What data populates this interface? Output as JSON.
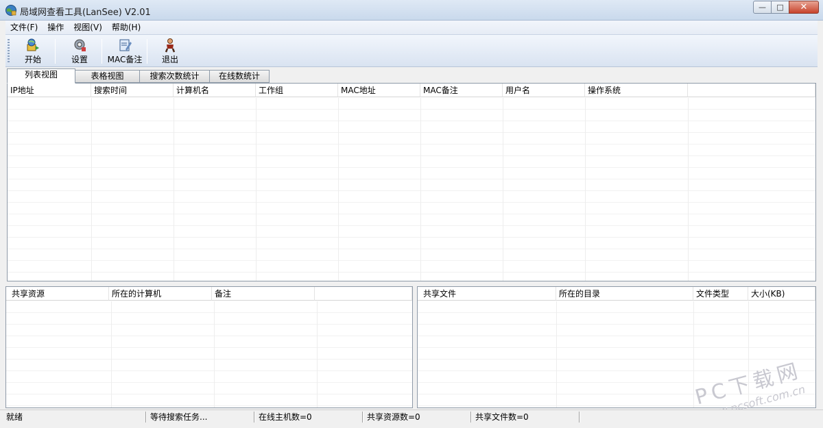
{
  "window": {
    "title": "局域网查看工具(LanSee) V2.01",
    "buttons": {
      "minimize": "—",
      "maximize": "□",
      "close": "✕"
    }
  },
  "menu": [
    "文件(F)",
    "操作",
    "视图(V)",
    "帮助(H)"
  ],
  "toolbar": [
    {
      "label": "开始",
      "icon": "start-icon"
    },
    {
      "label": "设置",
      "icon": "settings-icon"
    },
    {
      "label": "MAC备注",
      "icon": "mac-note-icon"
    },
    {
      "label": "退出",
      "icon": "exit-icon"
    }
  ],
  "tabs": [
    "列表视图",
    "表格视图",
    "搜索次数统计",
    "在线数统计"
  ],
  "main_table": {
    "columns": [
      "IP地址",
      "搜索时间",
      "计算机名",
      "工作组",
      "MAC地址",
      "MAC备注",
      "用户名",
      "操作系统",
      ""
    ]
  },
  "share_table": {
    "columns": [
      "共享资源",
      "所在的计算机",
      "备注",
      ""
    ]
  },
  "file_table": {
    "columns": [
      "共享文件",
      "所在的目录",
      "文件类型",
      "大小(KB)"
    ]
  },
  "status": [
    "就绪",
    "等待搜索任务...",
    "在线主机数=0",
    "共享资源数=0",
    "共享文件数=0"
  ],
  "watermark": {
    "main": "PC下载网",
    "sub": "www.pcsoft.com.cn"
  },
  "colors": {
    "titlebar": "#c9d9ec",
    "close": "#c7432c",
    "grid_line": "#f1f1f1"
  }
}
